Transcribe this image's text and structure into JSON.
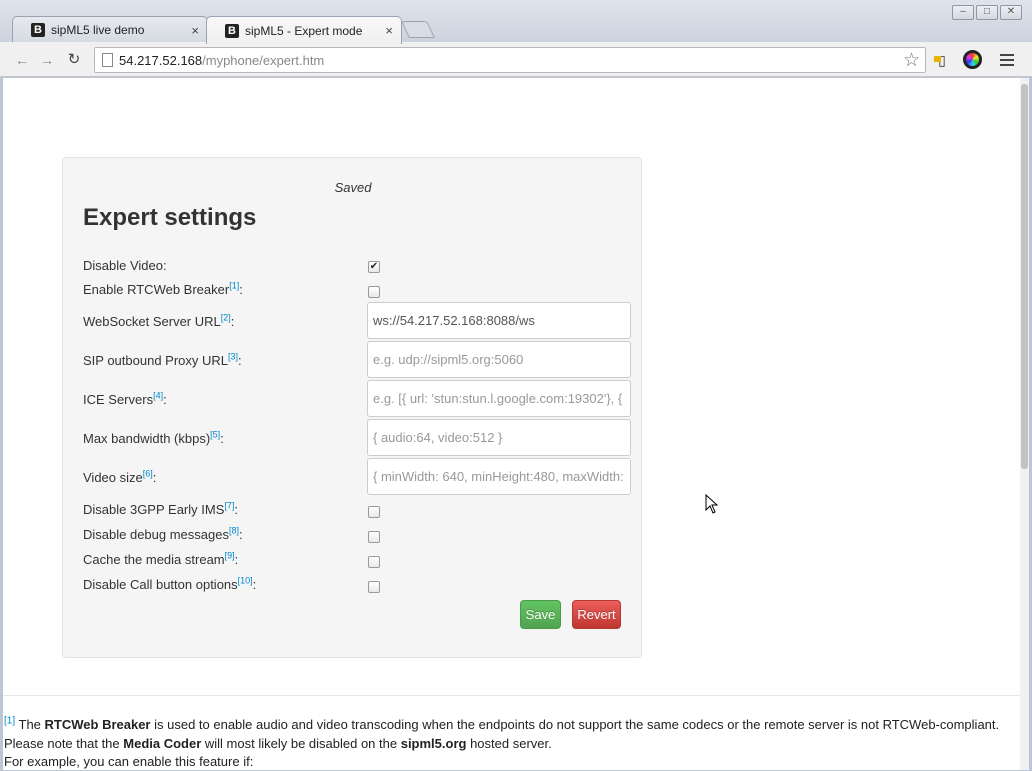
{
  "browser": {
    "tabs": [
      {
        "favicon": "B",
        "title": "sipML5 live demo",
        "close": "×"
      },
      {
        "favicon": "B",
        "title": "sipML5 - Expert mode",
        "close": "×"
      }
    ],
    "window_controls": {
      "minimize": "–",
      "maximize": "□",
      "close": "✕"
    },
    "nav": {
      "back": "←",
      "forward": "→",
      "reload": "↻"
    },
    "url_host": "54.217.52.168",
    "url_path": "/myphone/expert.htm",
    "bookmark_star": "☆"
  },
  "panel": {
    "status": "Saved",
    "title": "Expert settings",
    "fields": [
      {
        "label": "Disable Video:",
        "ref": "",
        "suffix": "",
        "type": "checkbox",
        "checked": true
      },
      {
        "label": "Enable RTCWeb Breaker",
        "ref": "[1]",
        "suffix": ":",
        "type": "checkbox",
        "checked": false
      },
      {
        "label": "WebSocket Server URL",
        "ref": "[2]",
        "suffix": ":",
        "type": "text",
        "value": "ws://54.217.52.168:8088/ws",
        "placeholder": ""
      },
      {
        "label": "SIP outbound Proxy URL",
        "ref": "[3]",
        "suffix": ":",
        "type": "text",
        "value": "",
        "placeholder": "e.g. udp://sipml5.org:5060"
      },
      {
        "label": "ICE Servers",
        "ref": "[4]",
        "suffix": ":",
        "type": "text",
        "value": "",
        "placeholder": "e.g. [{ url: 'stun:stun.l.google.com:19302'}, {"
      },
      {
        "label": "Max bandwidth (kbps)",
        "ref": "[5]",
        "suffix": ":",
        "type": "text",
        "value": "",
        "placeholder": "{ audio:64, video:512 }"
      },
      {
        "label": "Video size",
        "ref": "[6]",
        "suffix": ":",
        "type": "text",
        "value": "",
        "placeholder": "{ minWidth: 640, minHeight:480, maxWidth:"
      },
      {
        "label": "Disable 3GPP Early IMS",
        "ref": "[7]",
        "suffix": ":",
        "type": "checkbox",
        "checked": false
      },
      {
        "label": "Disable debug messages",
        "ref": "[8]",
        "suffix": ":",
        "type": "checkbox",
        "checked": false
      },
      {
        "label": "Cache the media stream",
        "ref": "[9]",
        "suffix": ":",
        "type": "checkbox",
        "checked": false
      },
      {
        "label": "Disable Call button options",
        "ref": "[10]",
        "suffix": ":",
        "type": "checkbox",
        "checked": false
      }
    ],
    "save_label": "Save",
    "revert_label": "Revert"
  },
  "footnote": {
    "ref": "[1]",
    "line1_a": "The ",
    "line1_b": "RTCWeb Breaker",
    "line1_c": " is used to enable audio and video transcoding when the endpoints do not support the same codecs or the remote server is not RTCWeb-compliant.",
    "line2_a": "Please note that the ",
    "line2_b": "Media Coder",
    "line2_c": " will most likely be disabled on the ",
    "line2_d": "sipml5.org",
    "line2_e": " hosted server.",
    "line3": "For example, you can enable this feature if:"
  },
  "colors": {
    "accent_link": "#0088cc",
    "save_button": "#5bb75b",
    "revert_button": "#da4f49"
  }
}
